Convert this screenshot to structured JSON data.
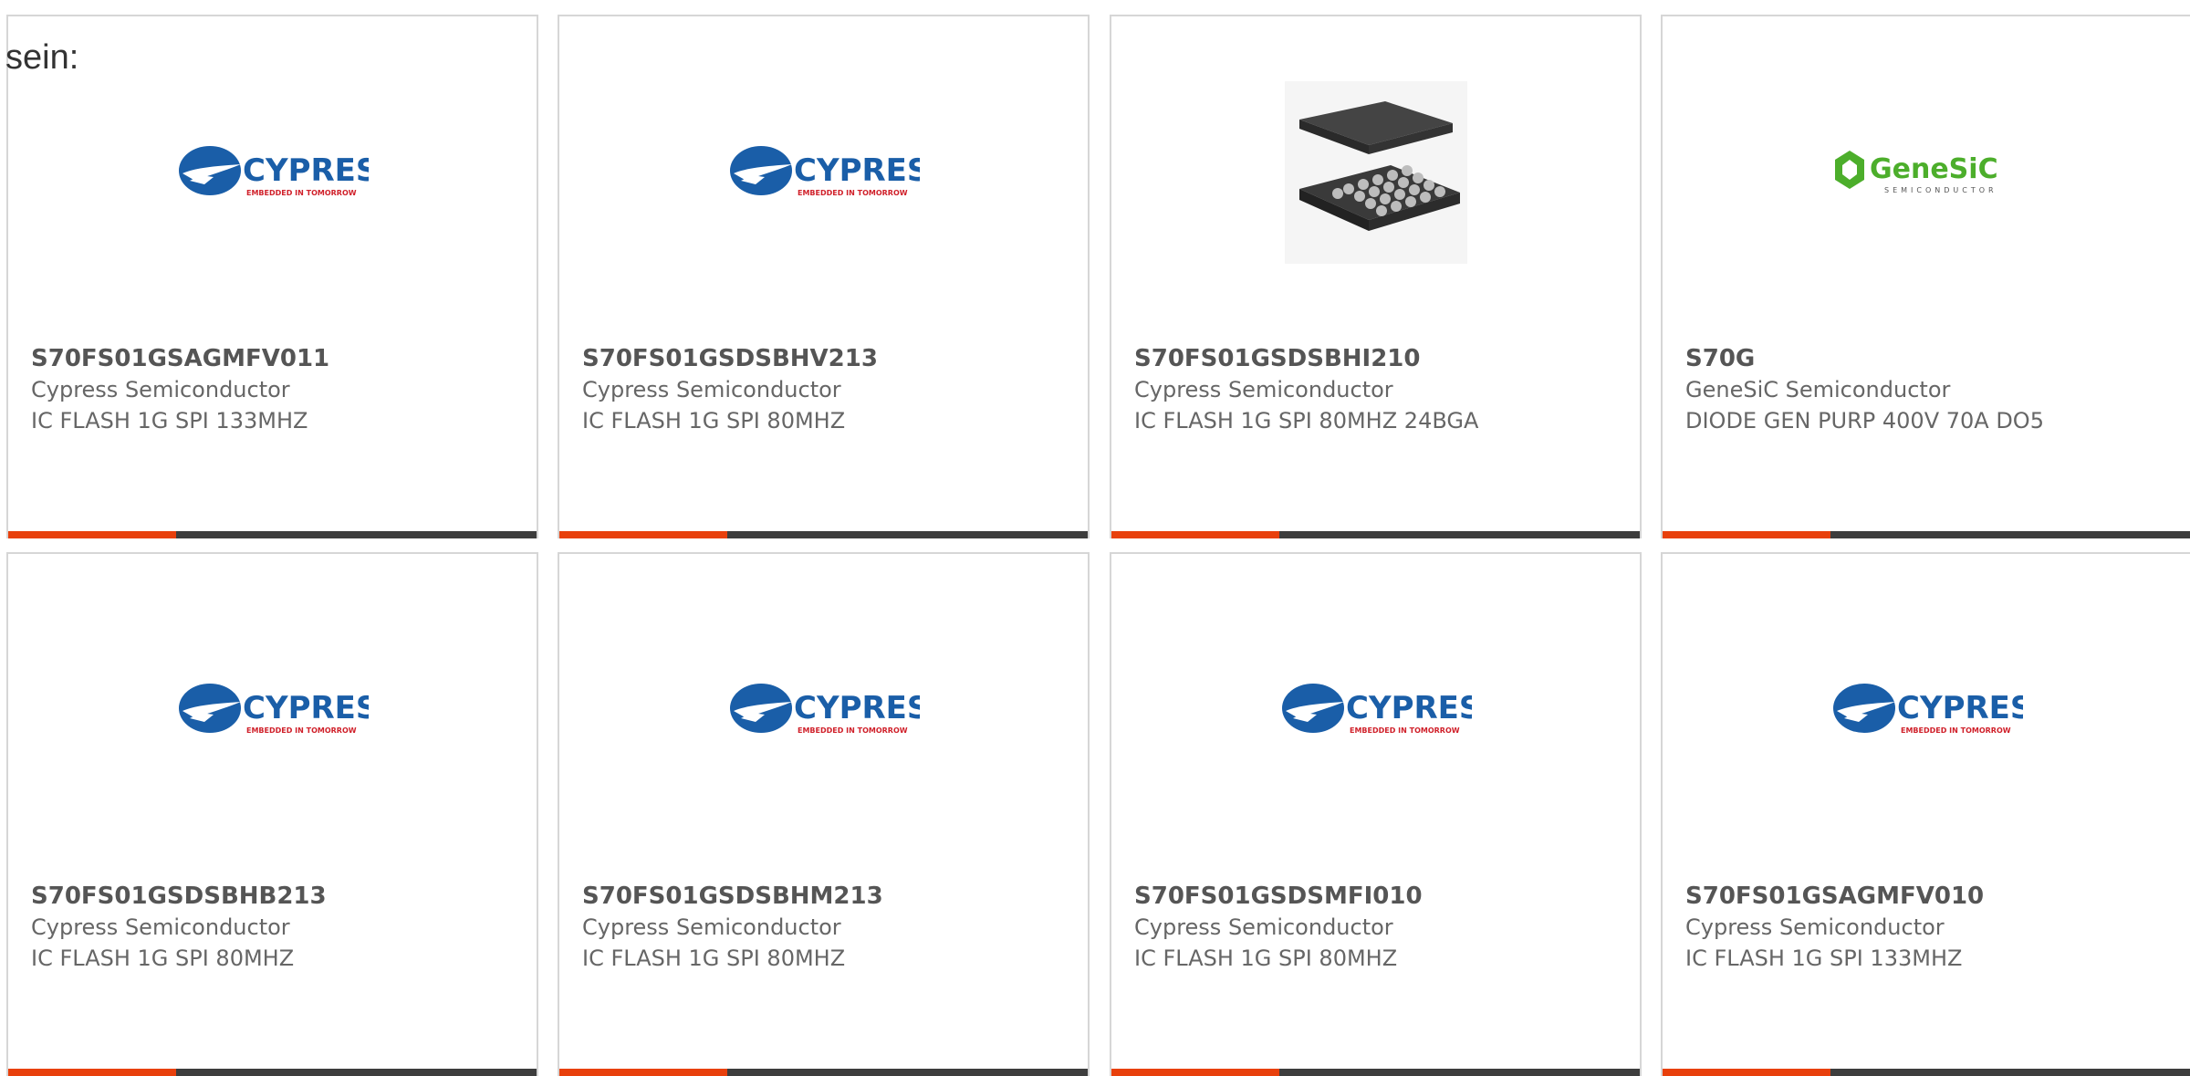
{
  "intro_text": "sein:",
  "colors": {
    "accent": "#e8400c",
    "bar": "#3d3d3d",
    "cypress_blue": "#1a5ea8",
    "cypress_red": "#d0202a",
    "genesic_green": "#4cae2b"
  },
  "logos": {
    "cypress": {
      "brand": "CYPRESS",
      "tagline": "EMBEDDED IN TOMORROW"
    },
    "genesic": {
      "brand": "GeneSiC",
      "tagline": "SEMICONDUCTOR"
    }
  },
  "products": [
    {
      "logo": "cypress-logo",
      "part_number": "S70FS01GSAGMFV011",
      "manufacturer": "Cypress Semiconductor",
      "description": "IC FLASH 1G SPI 133MHZ"
    },
    {
      "logo": "cypress-logo",
      "part_number": "S70FS01GSDSBHV213",
      "manufacturer": "Cypress Semiconductor",
      "description": "IC FLASH 1G SPI 80MHZ"
    },
    {
      "logo": "bga-chip-image",
      "part_number": "S70FS01GSDSBHI210",
      "manufacturer": "Cypress Semiconductor",
      "description": "IC FLASH 1G SPI 80MHZ 24BGA"
    },
    {
      "logo": "genesic-logo",
      "part_number": "S70G",
      "manufacturer": "GeneSiC Semiconductor",
      "description": "DIODE GEN PURP 400V 70A DO5"
    },
    {
      "logo": "cypress-logo",
      "part_number": "S70FS01GSDSBHB213",
      "manufacturer": "Cypress Semiconductor",
      "description": "IC FLASH 1G SPI 80MHZ"
    },
    {
      "logo": "cypress-logo",
      "part_number": "S70FS01GSDSBHM213",
      "manufacturer": "Cypress Semiconductor",
      "description": "IC FLASH 1G SPI 80MHZ"
    },
    {
      "logo": "cypress-logo",
      "part_number": "S70FS01GSDSMFI010",
      "manufacturer": "Cypress Semiconductor",
      "description": "IC FLASH 1G SPI 80MHZ"
    },
    {
      "logo": "cypress-logo",
      "part_number": "S70FS01GSAGMFV010",
      "manufacturer": "Cypress Semiconductor",
      "description": "IC FLASH 1G SPI 133MHZ"
    }
  ]
}
